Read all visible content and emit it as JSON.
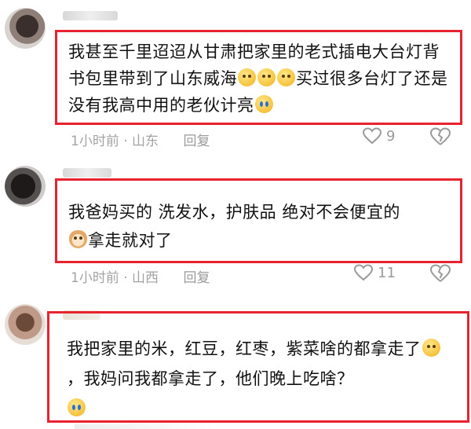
{
  "comments": [
    {
      "text_parts": [
        "我甚至千里迢迢从甘肃把家里的老式插电大台灯背书包里带到了山东威海",
        "买过很多台灯了还是没有我高中用的老伙计亮"
      ],
      "time": "1小时前",
      "location": "山东",
      "reply_label": "回复",
      "likes": "9"
    },
    {
      "text_parts": [
        "我爸妈买的 洗发水，护肤品  绝对不会便宜的",
        "拿走就对了"
      ],
      "time": "1小时前",
      "location": "山西",
      "reply_label": "回复",
      "likes": "11"
    },
    {
      "text_parts": [
        "我把家里的米，红豆，红枣，紫菜啥的都拿走了",
        "，我妈问我都拿走了，他们晚上吃啥？"
      ]
    }
  ],
  "separator": "·",
  "colors": {
    "highlight_border": "#e8222f",
    "meta_text": "#a3a3a3"
  },
  "icons": {
    "like": "heart-outline-icon",
    "dislike": "broken-heart-icon"
  }
}
